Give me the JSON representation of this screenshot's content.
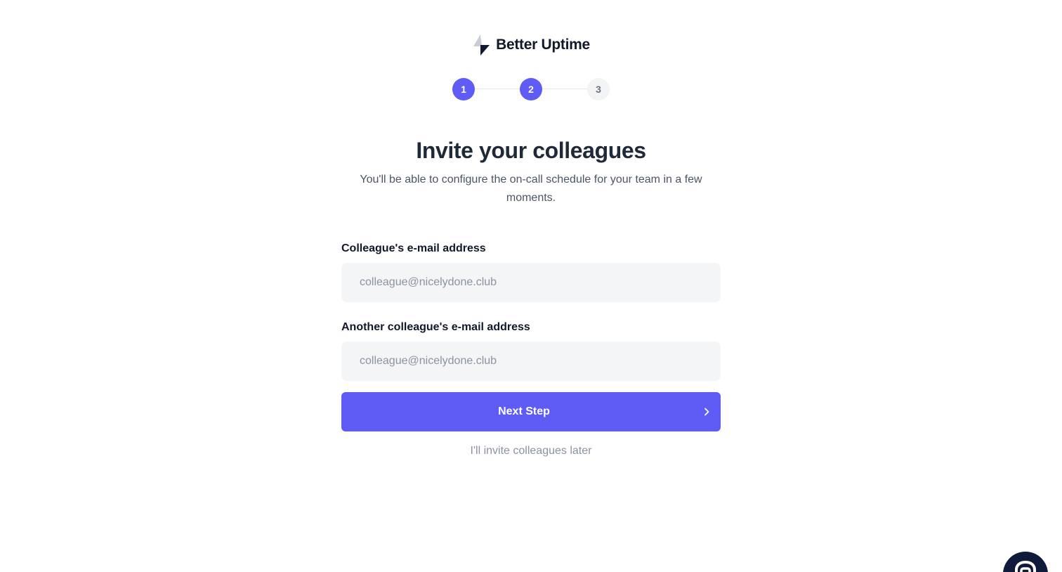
{
  "brand": {
    "name": "Better Uptime",
    "logo_icon": "lightning-bolt-icon"
  },
  "stepper": {
    "steps": [
      {
        "number": "1",
        "state": "complete"
      },
      {
        "number": "2",
        "state": "current"
      },
      {
        "number": "3",
        "state": "upcoming"
      }
    ]
  },
  "main": {
    "title": "Invite your colleagues",
    "subtitle": "You'll be able to configure the on-call schedule for your team in a few moments."
  },
  "form": {
    "fields": [
      {
        "label": "Colleague's e-mail address",
        "placeholder": "colleague@nicelydone.club",
        "value": ""
      },
      {
        "label": "Another colleague's e-mail address",
        "placeholder": "colleague@nicelydone.club",
        "value": ""
      }
    ],
    "submit_label": "Next Step",
    "submit_icon": "chevron-right-icon",
    "skip_label": "I'll invite colleagues later"
  },
  "chat_widget": {
    "icon": "chat-bubble-icon"
  },
  "colors": {
    "accent": "#5e5cf5",
    "input_background": "#f3f5f7",
    "heading": "#1f2937",
    "muted": "#8b93a0",
    "chat_widget": "#101a3a"
  }
}
